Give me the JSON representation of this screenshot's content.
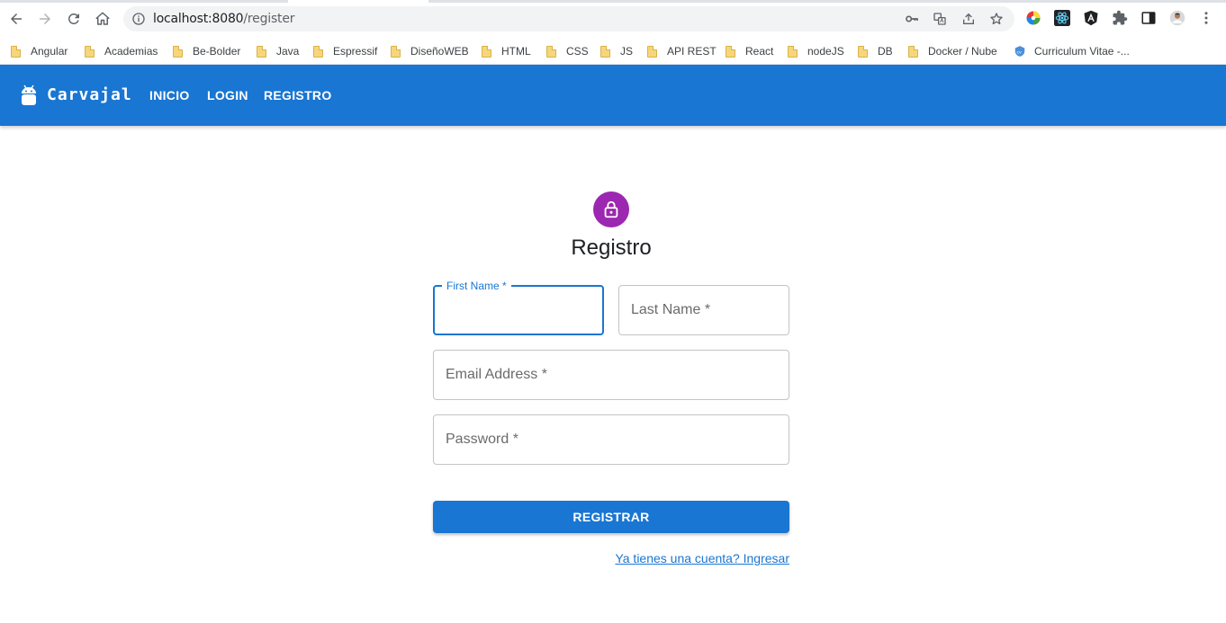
{
  "browser": {
    "url_host": "localhost:8080",
    "url_path": "/register",
    "bookmarks": [
      {
        "label": "Angular"
      },
      {
        "label": "Academias"
      },
      {
        "label": "Be-Bolder"
      },
      {
        "label": "Java"
      },
      {
        "label": "Espressif"
      },
      {
        "label": "DiseñoWEB"
      },
      {
        "label": "HTML"
      },
      {
        "label": "CSS"
      },
      {
        "label": "JS"
      },
      {
        "label": "API REST"
      },
      {
        "label": "React"
      },
      {
        "label": "nodeJS"
      },
      {
        "label": "DB"
      },
      {
        "label": "Docker / Nube"
      },
      {
        "label": "Curriculum Vitae -..."
      }
    ]
  },
  "appbar": {
    "brand": "Carvajal",
    "links": [
      "INICIO",
      "LOGIN",
      "REGISTRO"
    ],
    "color": "#1976d2"
  },
  "form": {
    "title": "Registro",
    "avatar_color": "#9c27b0",
    "first_name_label": "First Name *",
    "last_name_label": "Last Name *",
    "email_label": "Email Address *",
    "password_label": "Password *",
    "submit_label": "REGISTRAR",
    "login_link": "Ya tienes una cuenta? Ingresar"
  }
}
